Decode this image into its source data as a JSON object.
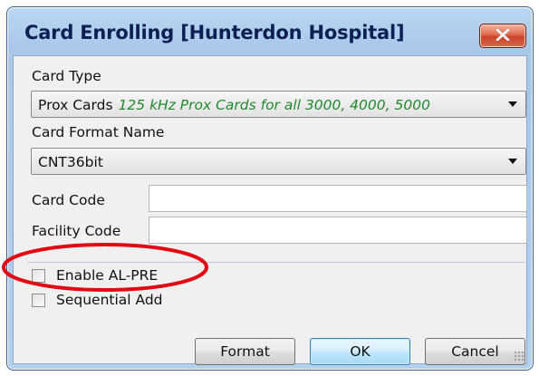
{
  "window": {
    "title": "Card Enrolling [Hunterdon Hospital]",
    "close_icon": "close-x-icon"
  },
  "card_type": {
    "label": "Card Type",
    "selected_value": "Prox Cards",
    "selected_description": "125 kHz Prox Cards for all 3000, 4000, 5000"
  },
  "card_format": {
    "label": "Card Format Name",
    "selected_value": "CNT36bit"
  },
  "card_code": {
    "label": "Card Code",
    "value": ""
  },
  "facility_code": {
    "label": "Facility Code",
    "value": ""
  },
  "options": {
    "enable_al_pre": {
      "label": "Enable AL-PRE",
      "checked": false
    },
    "sequential_add": {
      "label": "Sequential Add",
      "checked": false
    }
  },
  "buttons": {
    "format": "Format",
    "ok": "OK",
    "cancel": "Cancel"
  },
  "annotation": {
    "highlight_color": "#e30613",
    "target": "enable-al-pre-checkbox"
  },
  "colors": {
    "title_text": "#0b1f55",
    "description_text": "#1f8a2c",
    "close_button": "#c8432a"
  }
}
